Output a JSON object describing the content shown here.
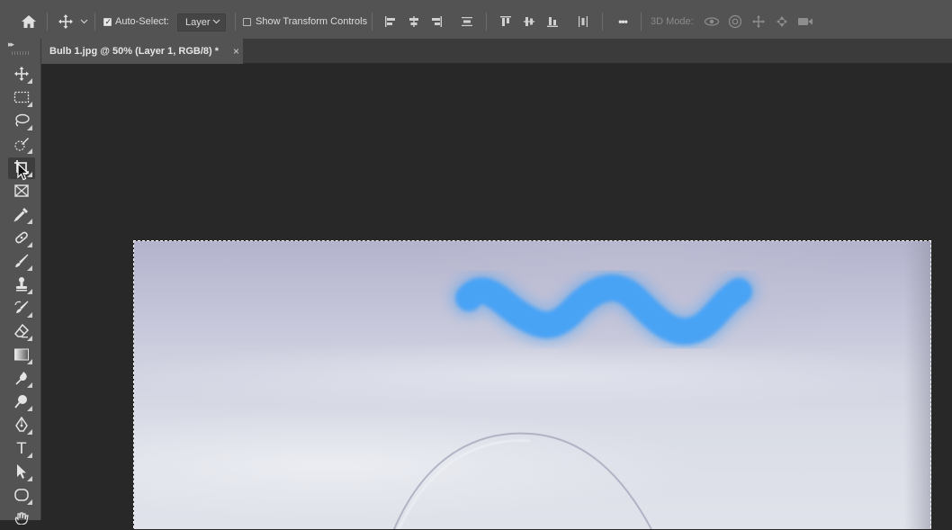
{
  "options_bar": {
    "auto_select": {
      "label": "Auto-Select:",
      "checked": true
    },
    "layer_select": {
      "value": "Layer"
    },
    "transform_controls": {
      "label": "Show Transform Controls",
      "checked": false
    },
    "more_label": "•••",
    "mode_3d_label": "3D Mode:"
  },
  "document_tab": {
    "title": "Bulb 1.jpg @ 50% (Layer 1, RGB/8) *",
    "close": "×"
  },
  "toolbar": {
    "collapse": "▸▸",
    "tools": [
      "move-tool",
      "rectangular-marquee-tool",
      "lasso-tool",
      "quick-selection-tool",
      "crop-tool",
      "frame-tool",
      "eyedropper-tool",
      "spot-healing-brush-tool",
      "brush-tool",
      "clone-stamp-tool",
      "history-brush-tool",
      "eraser-tool",
      "gradient-tool",
      "blur-tool",
      "dodge-tool",
      "pen-tool",
      "type-tool",
      "path-selection-tool",
      "ellipse-tool",
      "hand-tool"
    ],
    "active_tool": "crop-tool",
    "type_tool_glyph": "T"
  },
  "colors": {
    "ui_dark": "#282828",
    "panel": "#535353",
    "brush_stroke": "#4aa3f5"
  }
}
